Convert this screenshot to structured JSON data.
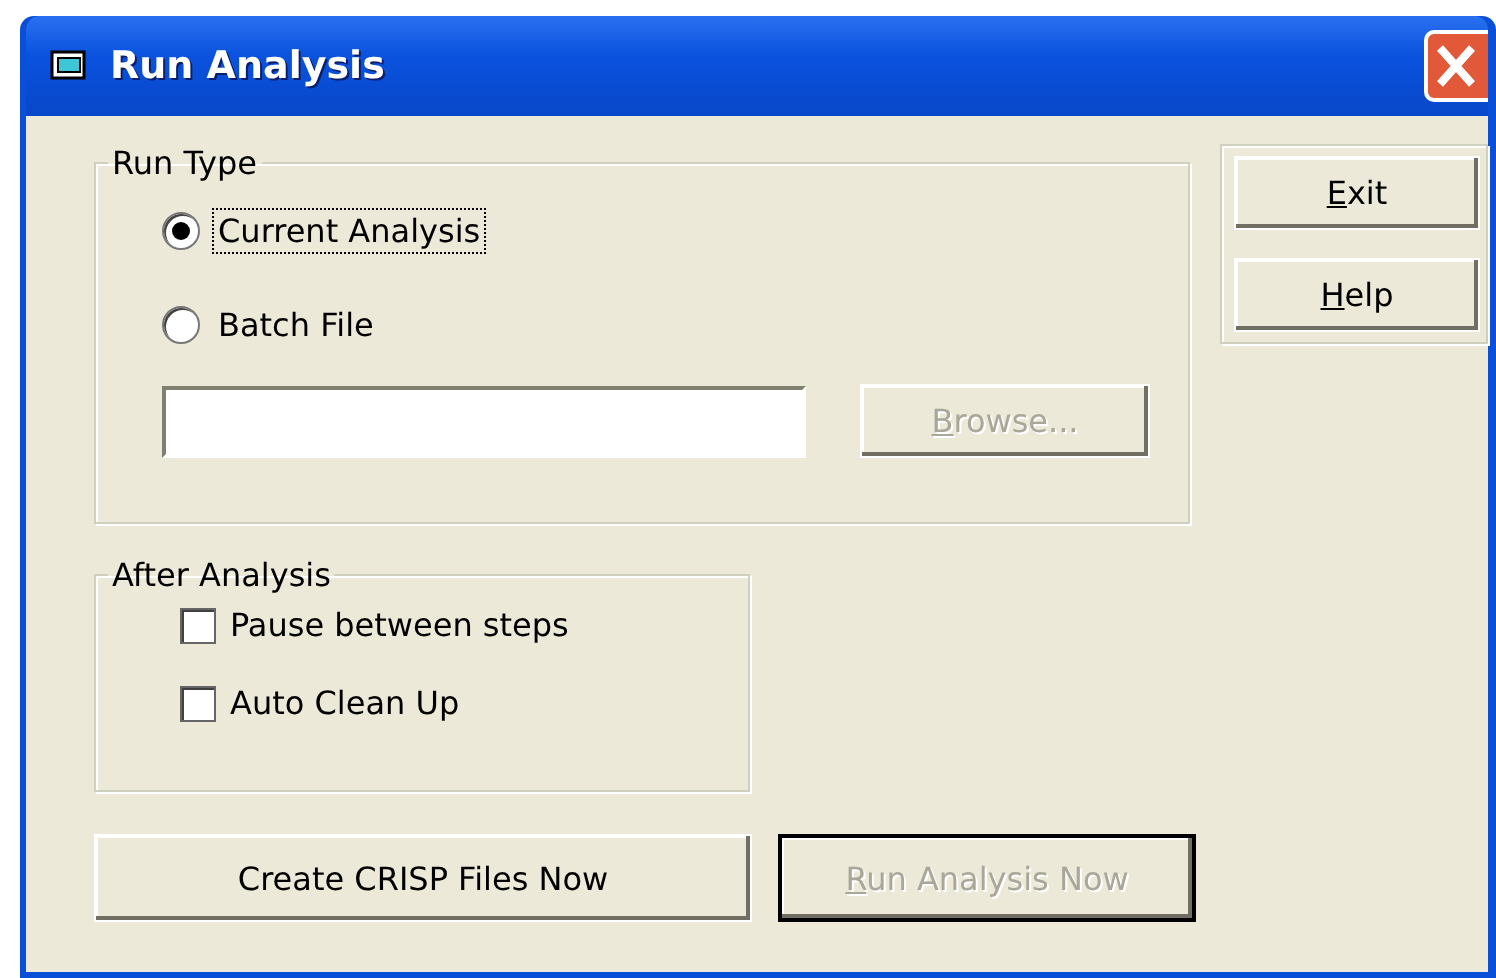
{
  "window": {
    "title": "Run Analysis"
  },
  "run_type": {
    "label": "Run Type",
    "options": [
      {
        "label": "Current Analysis",
        "selected": true,
        "focused": true
      },
      {
        "label": "Batch File",
        "selected": false,
        "focused": false
      }
    ],
    "browse_button": {
      "label": "Browse...",
      "underline_first": true,
      "disabled": true
    }
  },
  "side_buttons": [
    {
      "label": "Exit",
      "underline_first": true,
      "disabled": false
    },
    {
      "label": "Help",
      "underline_first": true,
      "disabled": false
    }
  ],
  "after_analysis": {
    "label": "After Analysis",
    "options": [
      {
        "label": "Pause between steps",
        "checked": false
      },
      {
        "label": "Auto Clean Up",
        "checked": false
      }
    ]
  },
  "actions": [
    {
      "label": "Create CRISP Files Now",
      "underline_first": false,
      "disabled": false,
      "default": false
    },
    {
      "label": "Run Analysis Now",
      "underline_first": true,
      "disabled": true,
      "default": true
    }
  ]
}
